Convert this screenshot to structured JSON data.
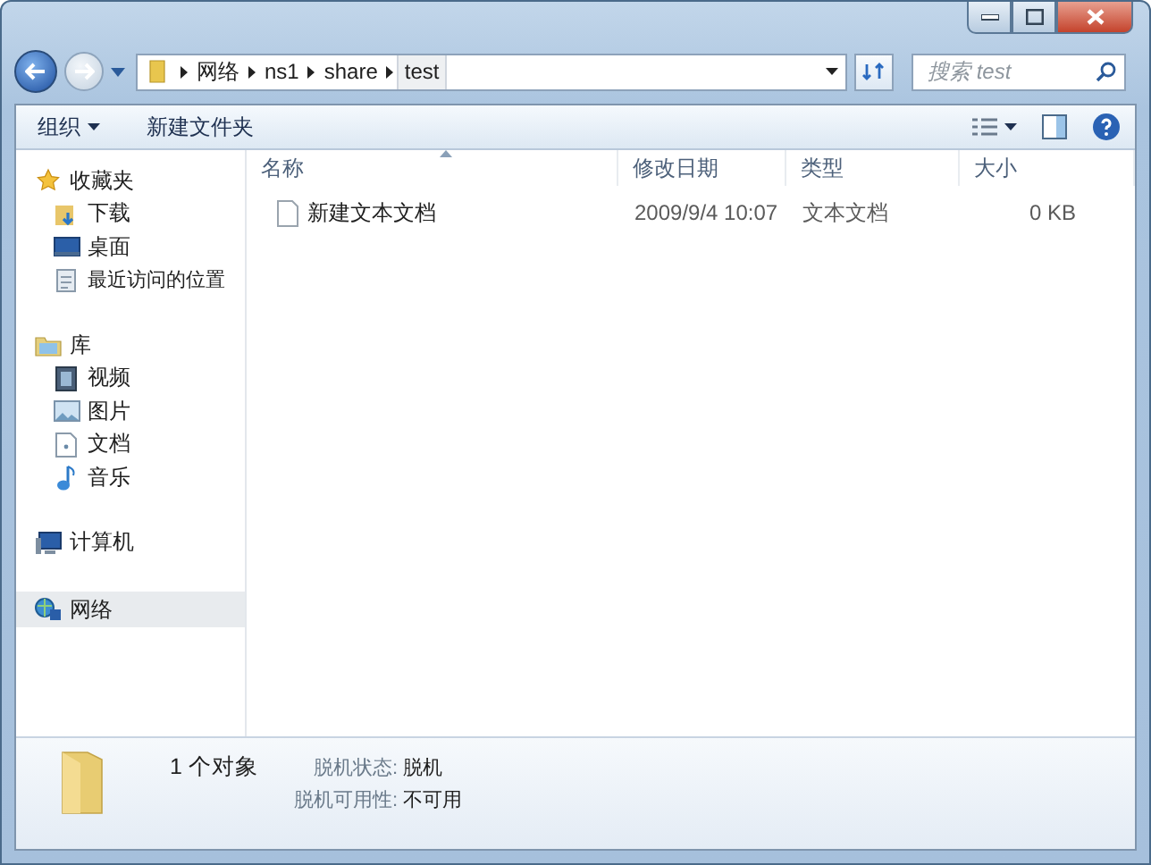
{
  "address_bar": {
    "path": [
      "网络",
      "ns1",
      "share",
      "test"
    ]
  },
  "search": {
    "placeholder": "搜索 test"
  },
  "toolbar": {
    "buttons": [
      {
        "label": "组织",
        "has_menu": true
      },
      {
        "label": "新建文件夹",
        "has_menu": false
      }
    ]
  },
  "sidebar": {
    "groups": [
      {
        "label": "收藏夹",
        "selected": false,
        "children": [
          {
            "label": "下载",
            "selected": false
          },
          {
            "label": "桌面",
            "selected": false
          },
          {
            "label": "最近访问的位置",
            "selected": false
          }
        ]
      },
      {
        "label": "库",
        "selected": false,
        "children": [
          {
            "label": "视频",
            "selected": false
          },
          {
            "label": "图片",
            "selected": false
          },
          {
            "label": "文档",
            "selected": false
          },
          {
            "label": "音乐",
            "selected": false
          }
        ]
      },
      {
        "label": "计算机",
        "selected": false
      },
      {
        "label": "网络",
        "selected": true
      }
    ]
  },
  "file_list": {
    "columns": [
      "名称",
      "修改日期",
      "类型",
      "大小"
    ],
    "rows": [
      {
        "cells": [
          "新建文本文档",
          "2009/9/4 10:07",
          "文本文档",
          "0 KB"
        ],
        "selected": false
      }
    ]
  },
  "status_bar": {
    "count": "1 个对象",
    "details": [
      {
        "label": "脱机状态:",
        "value": "脱机"
      },
      {
        "label": "脱机可用性:",
        "value": "不可用"
      }
    ]
  }
}
